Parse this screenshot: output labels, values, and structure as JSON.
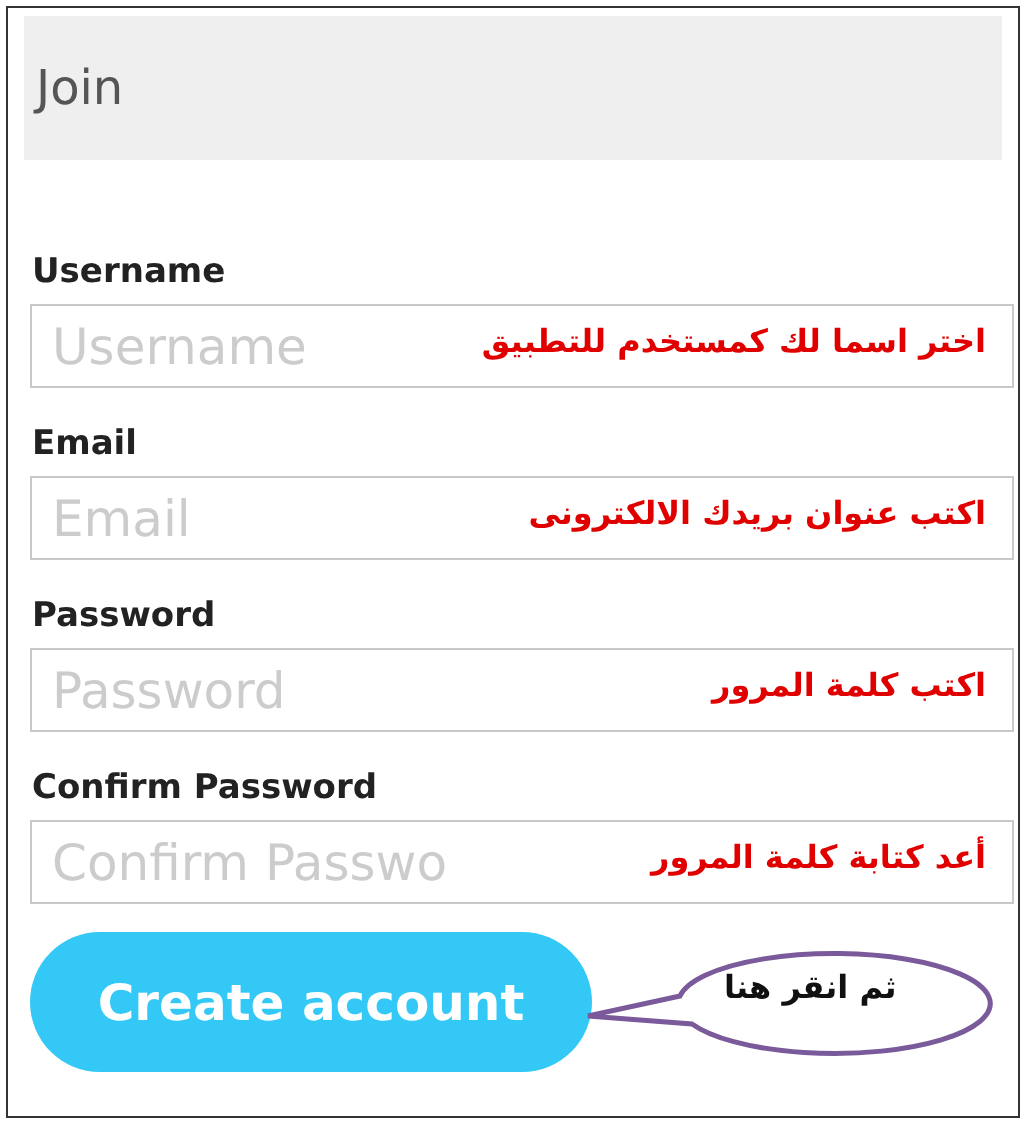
{
  "header": {
    "title": "Join"
  },
  "fields": [
    {
      "label": "Username",
      "placeholder": "Username",
      "note": "اختر اسما لك كمستخدم للتطبيق"
    },
    {
      "label": "Email",
      "placeholder": "Email",
      "note": "اكتب عنوان بريدك الالكترونى"
    },
    {
      "label": "Password",
      "placeholder": "Password",
      "note": "اكتب كلمة المرور"
    },
    {
      "label": "Confirm Password",
      "placeholder": "Confirm Passwo",
      "note": "أعد كتابة كلمة المرور"
    }
  ],
  "button": {
    "label": "Create account"
  },
  "callout": {
    "text": "ثم انقر هنا"
  }
}
